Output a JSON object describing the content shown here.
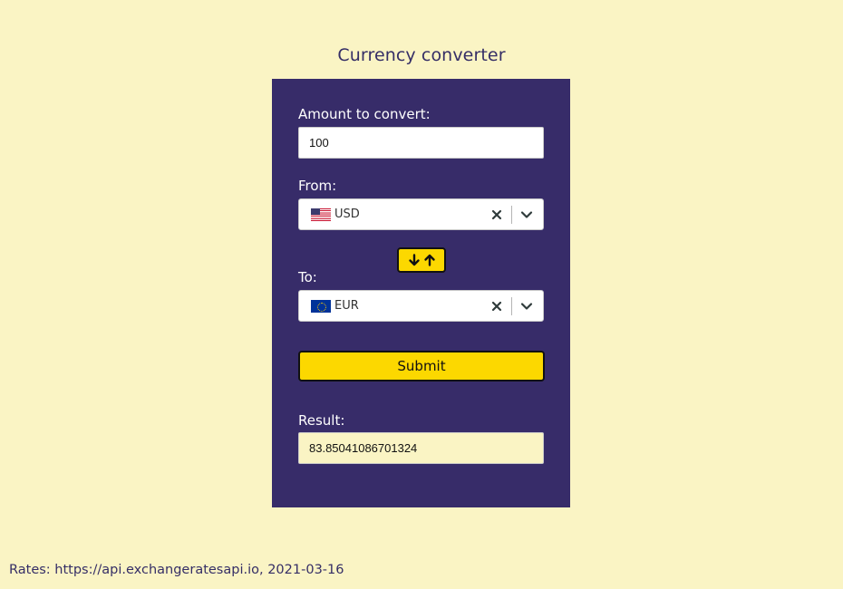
{
  "page": {
    "title": "Currency converter",
    "footer": "Rates: https://api.exchangeratesapi.io, 2021-03-16"
  },
  "form": {
    "amount_label": "Amount to convert:",
    "amount_value": "100",
    "from_label": "From:",
    "from_value": "USD",
    "from_flag": "us-flag-icon",
    "to_label": "To:",
    "to_value": "EUR",
    "to_flag": "eu-flag-icon",
    "swap_icons": [
      "arrow-down-icon",
      "arrow-up-icon"
    ],
    "submit_label": "Submit",
    "result_label": "Result:",
    "result_value": "83.85041086701324"
  },
  "colors": {
    "background": "#faf4c4",
    "panel": "#372c69",
    "accent": "#fcd800",
    "title_text": "#352e66"
  }
}
